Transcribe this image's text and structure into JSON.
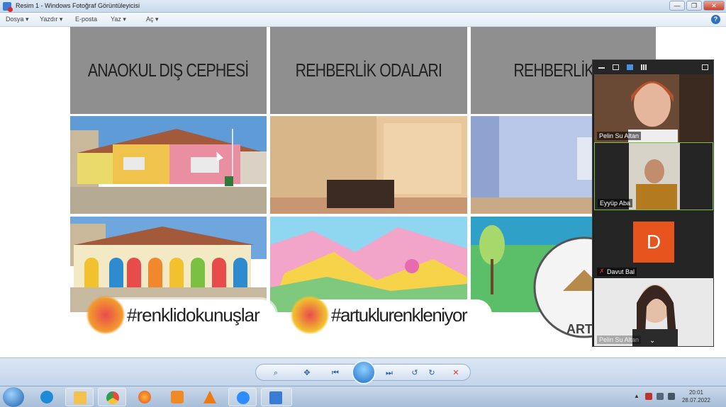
{
  "window": {
    "title": "Resim 1 - Windows Fotoğraf Görüntüleyicisi",
    "minimize": "—",
    "maximize": "❐",
    "close": "✕"
  },
  "menu": {
    "items": [
      "Dosya ▾",
      "Yazdır ▾",
      "E-posta",
      "Yaz ▾",
      "Aç ▾"
    ],
    "help": "?"
  },
  "slide": {
    "headers": [
      "ANAOKUL DIŞ CEPHESİ",
      "REHBERLİK ODALARI",
      "REHBERLİK OD"
    ],
    "hashtags": [
      "#renklidokunuşlar",
      "#artuklurenkleniyor"
    ],
    "logo_text": "ART"
  },
  "zoom": {
    "participants": [
      {
        "name": "Pelin Su Altan"
      },
      {
        "name": "Eyyüp Aba"
      },
      {
        "name": "Davut Bal",
        "initial": "D",
        "muted": true
      },
      {
        "name": "Pelin Su Altan"
      }
    ]
  },
  "taskbar": {
    "time": "20:01",
    "date": "28.07.2022"
  },
  "colors": {
    "zoom_avatar": "#e8541e",
    "active_speaker": "#7bc043",
    "header_gray": "#8f8f8f"
  }
}
